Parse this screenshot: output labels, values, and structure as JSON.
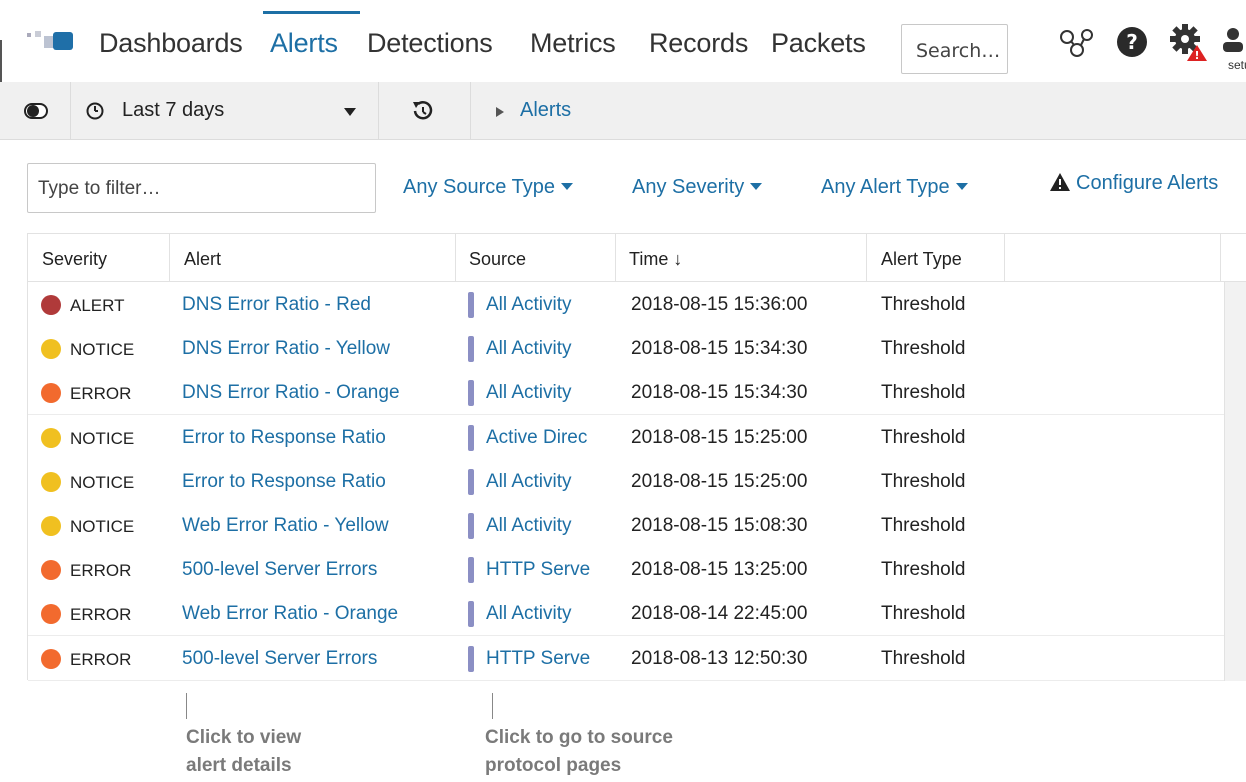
{
  "nav": {
    "items": [
      "Dashboards",
      "Alerts",
      "Detections",
      "Metrics",
      "Records",
      "Packets"
    ],
    "active": "Alerts",
    "search_placeholder": "Search…",
    "user_label": "setu"
  },
  "toolbar": {
    "time_range": "Last 7 days",
    "breadcrumb": "Alerts"
  },
  "filters": {
    "filter_placeholder": "Type to filter…",
    "source_type": "Any Source Type",
    "severity": "Any Severity",
    "alert_type": "Any Alert Type",
    "configure": "Configure Alerts"
  },
  "table": {
    "columns": [
      "Severity",
      "Alert",
      "Source",
      "Time ↓",
      "Alert Type"
    ],
    "rows": [
      {
        "severity": "ALERT",
        "alert": "DNS Error Ratio - Red",
        "source": "All Activity",
        "time": "2018-08-15 15:36:00",
        "type": "Threshold"
      },
      {
        "severity": "NOTICE",
        "alert": "DNS Error Ratio - Yellow",
        "source": "All Activity",
        "time": "2018-08-15 15:34:30",
        "type": "Threshold"
      },
      {
        "severity": "ERROR",
        "alert": "DNS Error Ratio - Orange",
        "source": "All Activity",
        "time": "2018-08-15 15:34:30",
        "type": "Threshold"
      },
      {
        "severity": "NOTICE",
        "alert": "Error to Response Ratio",
        "source": "Active Direc",
        "time": "2018-08-15 15:25:00",
        "type": "Threshold"
      },
      {
        "severity": "NOTICE",
        "alert": "Error to Response Ratio",
        "source": "All Activity",
        "time": "2018-08-15 15:25:00",
        "type": "Threshold"
      },
      {
        "severity": "NOTICE",
        "alert": "Web Error Ratio - Yellow",
        "source": "All Activity",
        "time": "2018-08-15 15:08:30",
        "type": "Threshold"
      },
      {
        "severity": "ERROR",
        "alert": "500-level Server Errors",
        "source": "HTTP Serve",
        "time": "2018-08-15 13:25:00",
        "type": "Threshold"
      },
      {
        "severity": "ERROR",
        "alert": "Web Error Ratio - Orange",
        "source": "All Activity",
        "time": "2018-08-14 22:45:00",
        "type": "Threshold"
      },
      {
        "severity": "ERROR",
        "alert": "500-level Server Errors",
        "source": "HTTP Serve",
        "time": "2018-08-13 12:50:30",
        "type": "Threshold"
      }
    ]
  },
  "severity_colors": {
    "ALERT": "#b03a3a",
    "NOTICE": "#f0c020",
    "ERROR": "#f26a2e"
  },
  "colors": {
    "accent": "#1d6fa5",
    "source_bar": "#8b8fc4"
  },
  "annotations": {
    "alert": "Click to view\nalert details",
    "source": "Click to go to source\nprotocol pages"
  }
}
